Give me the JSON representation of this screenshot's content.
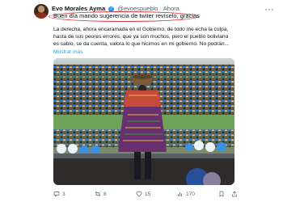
{
  "tweet": {
    "author_name": "Evo Morales Ayma",
    "author_handle": "@evoespueblo",
    "separator": "·",
    "time": "Ahora",
    "subtitle": "Buen día mando sugerencia de twiter revíselo, gracias",
    "body_lines": [
      "La derecha, ahora encaramada en el Gobierno, de todo me echa la culpa,",
      "hasta de sus peores errores, que ya son muchos,  pero el pueblo boliviano",
      "es sabio, se da cuenta, valora lo que hicimos en mi gobierno. No podrán..."
    ],
    "show_more_label": "Mostrar más",
    "more_icon": "more-horizontal-icon",
    "verified_icon": "verified-badge-icon",
    "accent_color": "#1d9bf0",
    "highlight_color": "#d9323a"
  },
  "actions": {
    "replies": "3",
    "reposts": "8",
    "likes": "15",
    "views": "170",
    "icons": [
      "reply-icon",
      "repost-icon",
      "like-icon",
      "views-icon",
      "bookmark-icon",
      "share-icon"
    ]
  }
}
